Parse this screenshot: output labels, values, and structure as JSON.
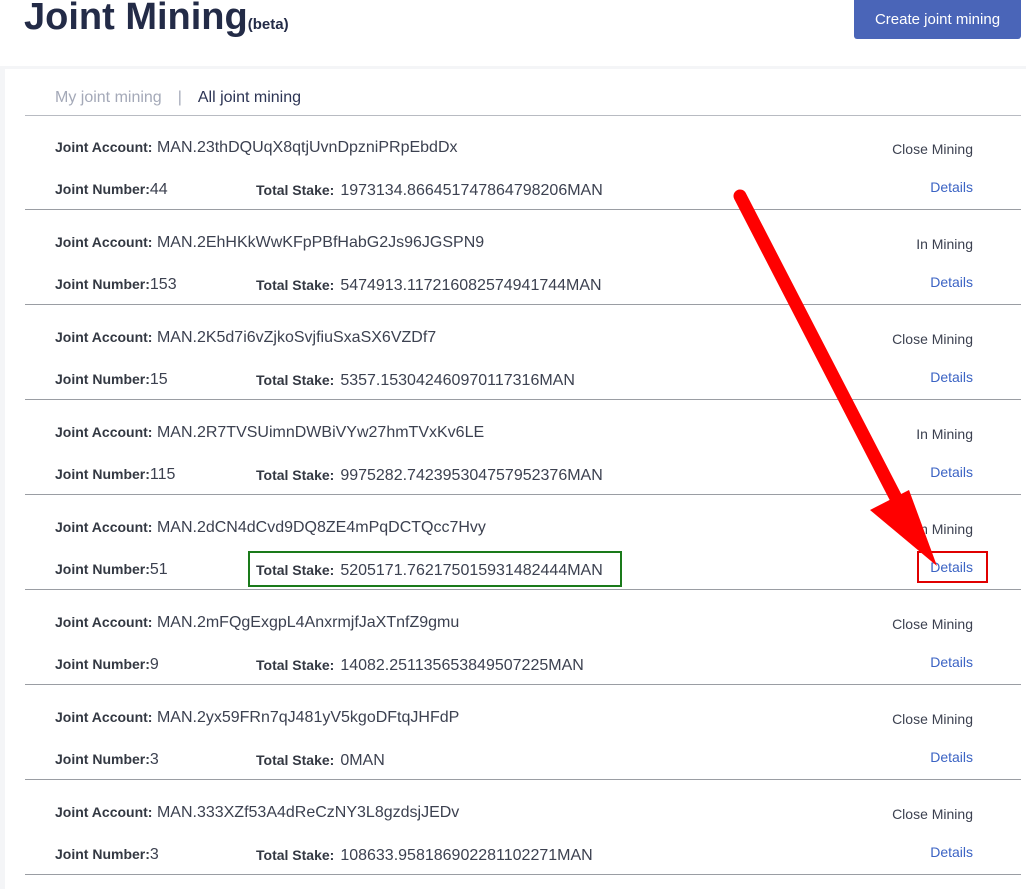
{
  "header": {
    "title": "Joint Mining",
    "beta": "(beta)",
    "create_button": "Create joint mining"
  },
  "tabs": {
    "mine": "My joint mining",
    "separator": "|",
    "all": "All joint mining"
  },
  "labels": {
    "account": "Joint Account:",
    "number": "Joint Number:",
    "stake": "Total Stake:",
    "details": "Details"
  },
  "rows": [
    {
      "account": "MAN.23thDQUqX8qtjUvnDpzniPRpEbdDx",
      "number": "44",
      "stake": "1973134.866451747864798206MAN",
      "status": "Close Mining"
    },
    {
      "account": "MAN.2EhHKkWwKFpPBfHabG2Js96JGSPN9",
      "number": "153",
      "stake": "5474913.117216082574941744MAN",
      "status": "In Mining"
    },
    {
      "account": "MAN.2K5d7i6vZjkoSvjfiuSxaSX6VZDf7",
      "number": "15",
      "stake": "5357.153042460970117316MAN",
      "status": "Close Mining"
    },
    {
      "account": "MAN.2R7TVSUimnDWBiVYw27hmTVxKv6LE",
      "number": "115",
      "stake": "9975282.742395304757952376MAN",
      "status": "In Mining"
    },
    {
      "account": "MAN.2dCN4dCvd9DQ8ZE4mPqDCTQcc7Hvy",
      "number": "51",
      "stake": "5205171.762175015931482444MAN",
      "status": "In Mining"
    },
    {
      "account": "MAN.2mFQgExgpL4AnxrmjfJaXTnfZ9gmu",
      "number": "9",
      "stake": "14082.251135653849507225MAN",
      "status": "Close Mining"
    },
    {
      "account": "MAN.2yx59FRn7qJ481yV5kgoDFtqJHFdP",
      "number": "3",
      "stake": "0MAN",
      "status": "Close Mining"
    },
    {
      "account": "MAN.333XZf53A4dReCzNY3L8gzdsjJEDv",
      "number": "3",
      "stake": "108633.958186902281102271MAN",
      "status": "Close Mining"
    }
  ],
  "annotations": {
    "arrow_color": "#ff0000",
    "stake_box_color": "#1a7a1a",
    "details_box_color": "#e00000"
  }
}
